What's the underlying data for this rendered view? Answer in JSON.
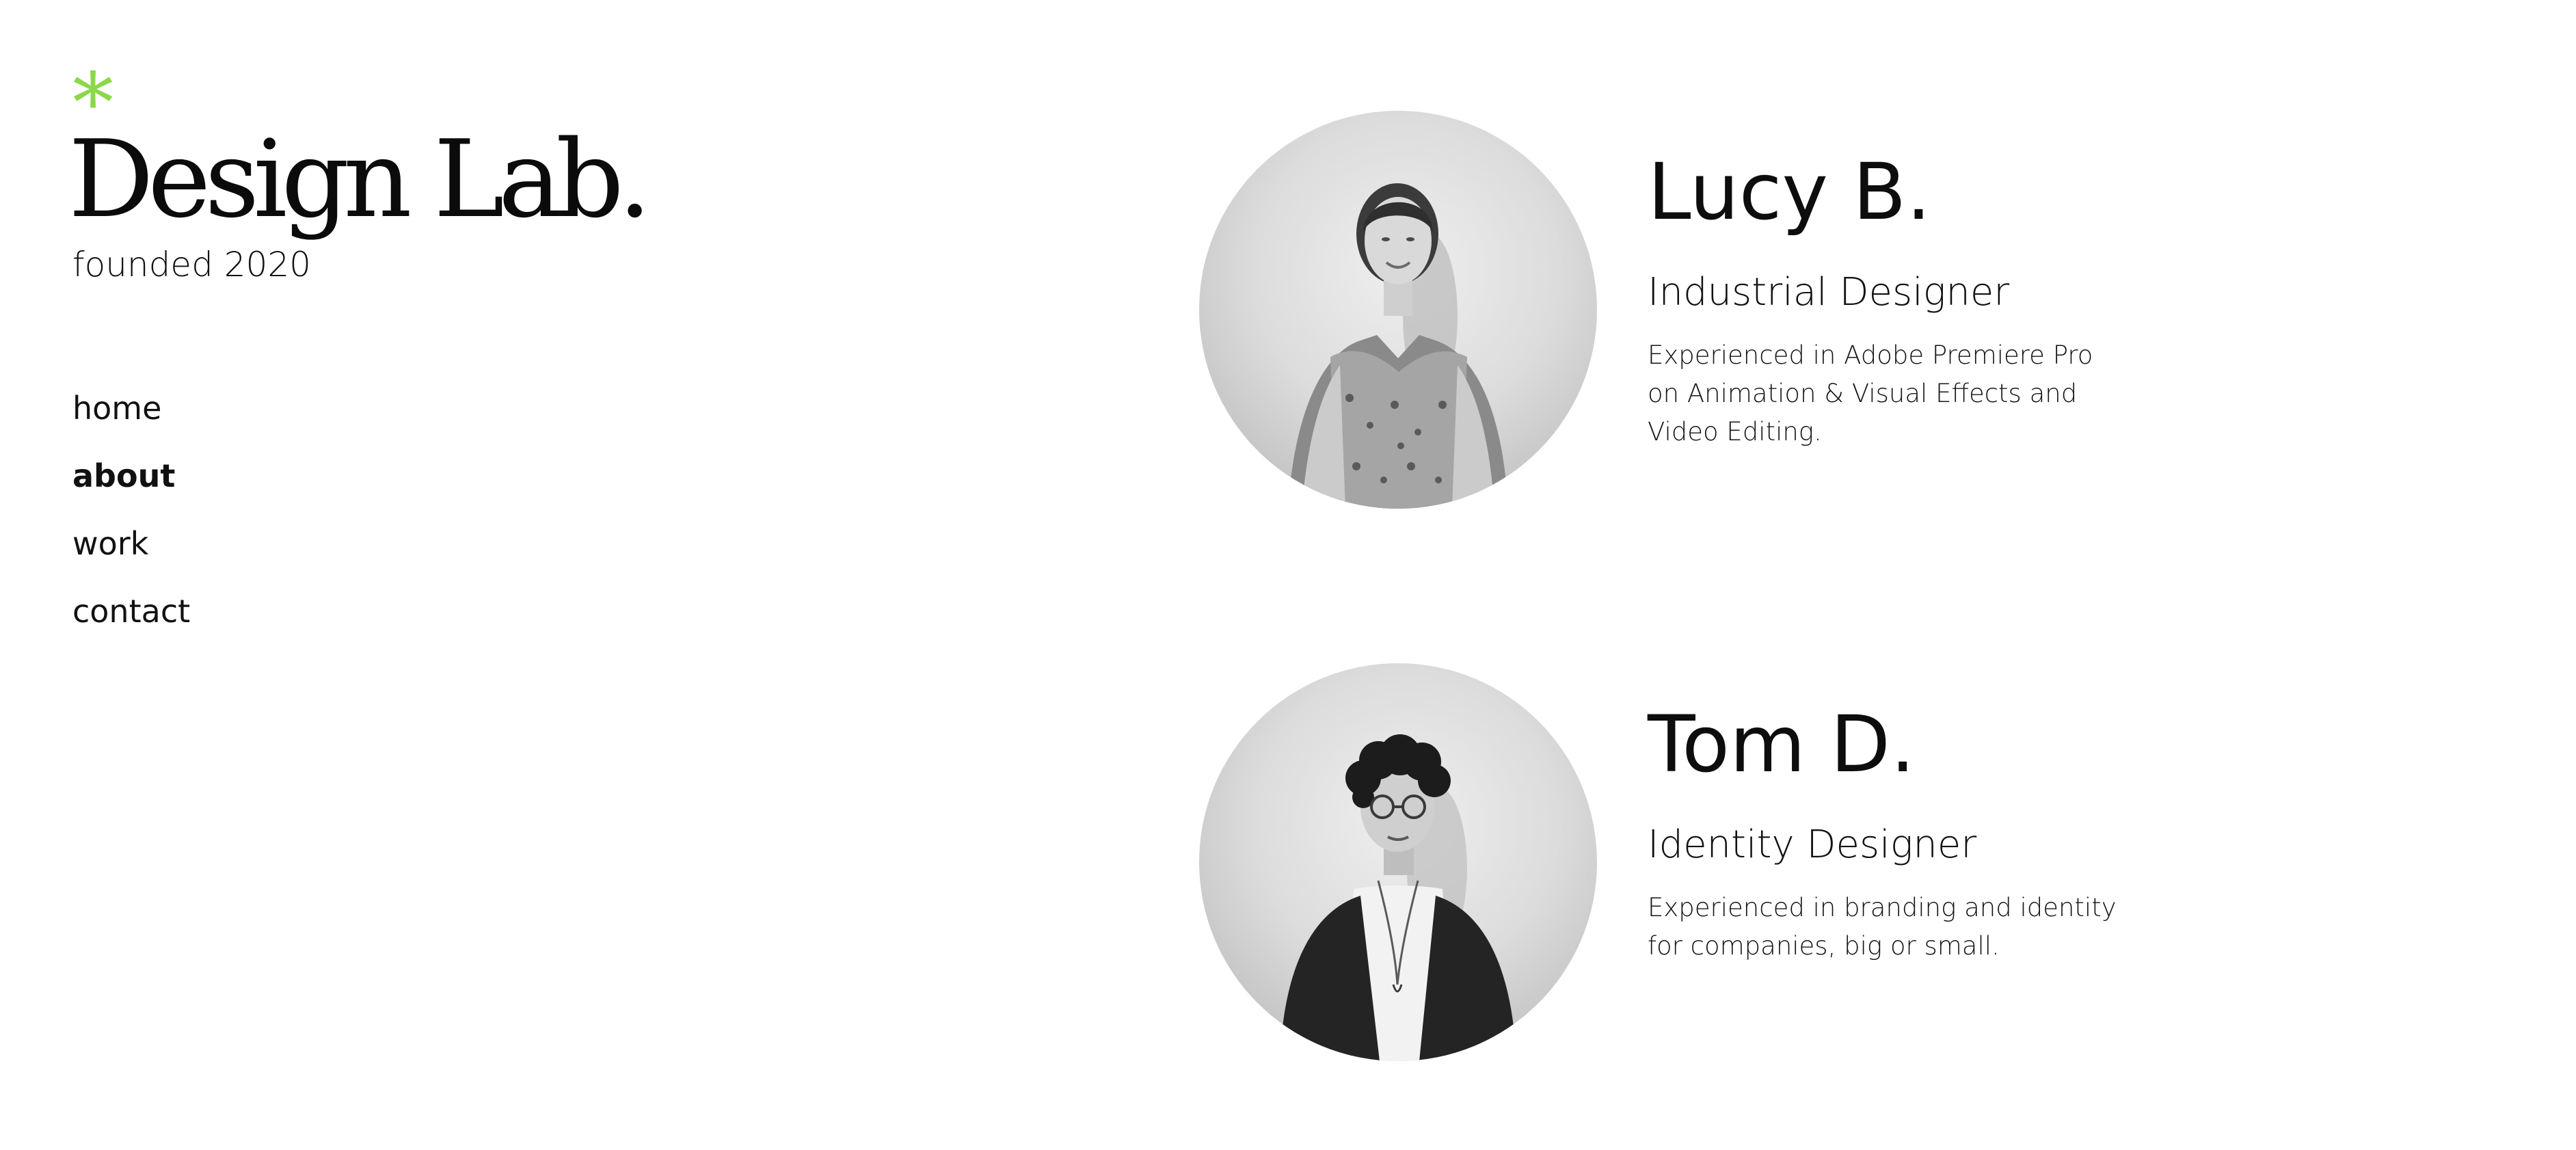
{
  "brand": {
    "asterisk": "*",
    "title": "Design Lab.",
    "founded": "founded 2020",
    "accent_color": "#8BD84A"
  },
  "nav": {
    "items": [
      {
        "label": "home",
        "active": false
      },
      {
        "label": "about",
        "active": true
      },
      {
        "label": "work",
        "active": false
      },
      {
        "label": "contact",
        "active": false
      }
    ]
  },
  "team": [
    {
      "name": "Lucy B.",
      "role": "Industrial Designer",
      "description": "Experienced in Adobe Premiere Pro on Animation & Visual Effects and Video Editing.",
      "photo_icon": "portrait-photo"
    },
    {
      "name": "Tom D.",
      "role": "Identity Designer",
      "description": "Experienced in branding and identity for companies, big or small.",
      "photo_icon": "portrait-photo"
    }
  ]
}
